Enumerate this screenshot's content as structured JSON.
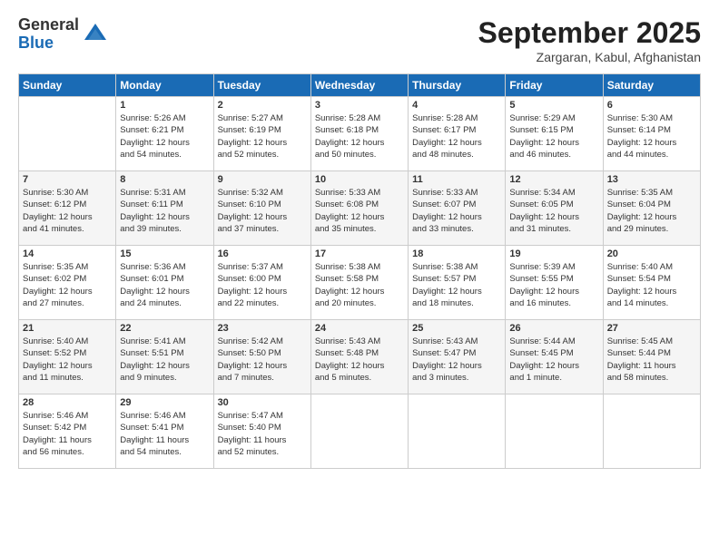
{
  "logo": {
    "general": "General",
    "blue": "Blue"
  },
  "title": "September 2025",
  "location": "Zargaran, Kabul, Afghanistan",
  "days_of_week": [
    "Sunday",
    "Monday",
    "Tuesday",
    "Wednesday",
    "Thursday",
    "Friday",
    "Saturday"
  ],
  "weeks": [
    [
      {
        "day": "",
        "info": ""
      },
      {
        "day": "1",
        "info": "Sunrise: 5:26 AM\nSunset: 6:21 PM\nDaylight: 12 hours\nand 54 minutes."
      },
      {
        "day": "2",
        "info": "Sunrise: 5:27 AM\nSunset: 6:19 PM\nDaylight: 12 hours\nand 52 minutes."
      },
      {
        "day": "3",
        "info": "Sunrise: 5:28 AM\nSunset: 6:18 PM\nDaylight: 12 hours\nand 50 minutes."
      },
      {
        "day": "4",
        "info": "Sunrise: 5:28 AM\nSunset: 6:17 PM\nDaylight: 12 hours\nand 48 minutes."
      },
      {
        "day": "5",
        "info": "Sunrise: 5:29 AM\nSunset: 6:15 PM\nDaylight: 12 hours\nand 46 minutes."
      },
      {
        "day": "6",
        "info": "Sunrise: 5:30 AM\nSunset: 6:14 PM\nDaylight: 12 hours\nand 44 minutes."
      }
    ],
    [
      {
        "day": "7",
        "info": "Sunrise: 5:30 AM\nSunset: 6:12 PM\nDaylight: 12 hours\nand 41 minutes."
      },
      {
        "day": "8",
        "info": "Sunrise: 5:31 AM\nSunset: 6:11 PM\nDaylight: 12 hours\nand 39 minutes."
      },
      {
        "day": "9",
        "info": "Sunrise: 5:32 AM\nSunset: 6:10 PM\nDaylight: 12 hours\nand 37 minutes."
      },
      {
        "day": "10",
        "info": "Sunrise: 5:33 AM\nSunset: 6:08 PM\nDaylight: 12 hours\nand 35 minutes."
      },
      {
        "day": "11",
        "info": "Sunrise: 5:33 AM\nSunset: 6:07 PM\nDaylight: 12 hours\nand 33 minutes."
      },
      {
        "day": "12",
        "info": "Sunrise: 5:34 AM\nSunset: 6:05 PM\nDaylight: 12 hours\nand 31 minutes."
      },
      {
        "day": "13",
        "info": "Sunrise: 5:35 AM\nSunset: 6:04 PM\nDaylight: 12 hours\nand 29 minutes."
      }
    ],
    [
      {
        "day": "14",
        "info": "Sunrise: 5:35 AM\nSunset: 6:02 PM\nDaylight: 12 hours\nand 27 minutes."
      },
      {
        "day": "15",
        "info": "Sunrise: 5:36 AM\nSunset: 6:01 PM\nDaylight: 12 hours\nand 24 minutes."
      },
      {
        "day": "16",
        "info": "Sunrise: 5:37 AM\nSunset: 6:00 PM\nDaylight: 12 hours\nand 22 minutes."
      },
      {
        "day": "17",
        "info": "Sunrise: 5:38 AM\nSunset: 5:58 PM\nDaylight: 12 hours\nand 20 minutes."
      },
      {
        "day": "18",
        "info": "Sunrise: 5:38 AM\nSunset: 5:57 PM\nDaylight: 12 hours\nand 18 minutes."
      },
      {
        "day": "19",
        "info": "Sunrise: 5:39 AM\nSunset: 5:55 PM\nDaylight: 12 hours\nand 16 minutes."
      },
      {
        "day": "20",
        "info": "Sunrise: 5:40 AM\nSunset: 5:54 PM\nDaylight: 12 hours\nand 14 minutes."
      }
    ],
    [
      {
        "day": "21",
        "info": "Sunrise: 5:40 AM\nSunset: 5:52 PM\nDaylight: 12 hours\nand 11 minutes."
      },
      {
        "day": "22",
        "info": "Sunrise: 5:41 AM\nSunset: 5:51 PM\nDaylight: 12 hours\nand 9 minutes."
      },
      {
        "day": "23",
        "info": "Sunrise: 5:42 AM\nSunset: 5:50 PM\nDaylight: 12 hours\nand 7 minutes."
      },
      {
        "day": "24",
        "info": "Sunrise: 5:43 AM\nSunset: 5:48 PM\nDaylight: 12 hours\nand 5 minutes."
      },
      {
        "day": "25",
        "info": "Sunrise: 5:43 AM\nSunset: 5:47 PM\nDaylight: 12 hours\nand 3 minutes."
      },
      {
        "day": "26",
        "info": "Sunrise: 5:44 AM\nSunset: 5:45 PM\nDaylight: 12 hours\nand 1 minute."
      },
      {
        "day": "27",
        "info": "Sunrise: 5:45 AM\nSunset: 5:44 PM\nDaylight: 11 hours\nand 58 minutes."
      }
    ],
    [
      {
        "day": "28",
        "info": "Sunrise: 5:46 AM\nSunset: 5:42 PM\nDaylight: 11 hours\nand 56 minutes."
      },
      {
        "day": "29",
        "info": "Sunrise: 5:46 AM\nSunset: 5:41 PM\nDaylight: 11 hours\nand 54 minutes."
      },
      {
        "day": "30",
        "info": "Sunrise: 5:47 AM\nSunset: 5:40 PM\nDaylight: 11 hours\nand 52 minutes."
      },
      {
        "day": "",
        "info": ""
      },
      {
        "day": "",
        "info": ""
      },
      {
        "day": "",
        "info": ""
      },
      {
        "day": "",
        "info": ""
      }
    ]
  ]
}
